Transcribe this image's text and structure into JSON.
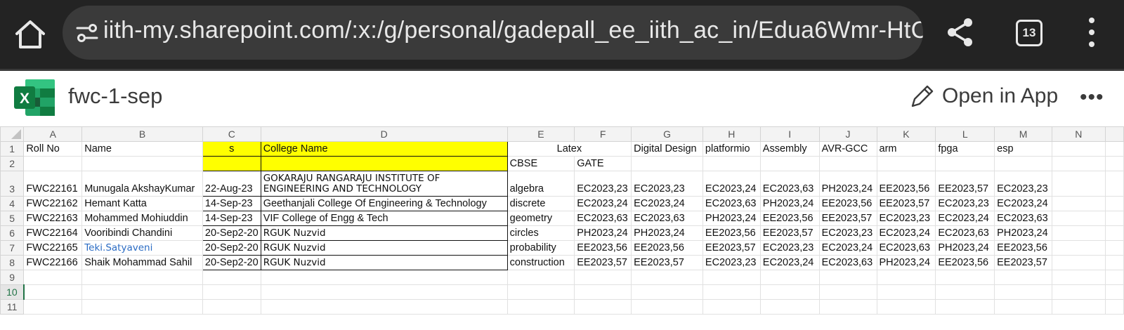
{
  "browser": {
    "url": "iith-my.sharepoint.com/:x:/g/personal/gadepall_ee_iith_ac_in/Edua6Wmr-HtC",
    "tab_count": "13"
  },
  "app": {
    "file_title": "fwc-1-sep",
    "open_in_app_label": "Open in App",
    "more_label": "•••",
    "accent_color": "#217346"
  },
  "grid": {
    "column_headers": [
      "A",
      "B",
      "C",
      "D",
      "E",
      "F",
      "G",
      "H",
      "I",
      "J",
      "K",
      "L",
      "M",
      "N"
    ],
    "row_numbers": [
      "1",
      "2",
      "3",
      "4",
      "5",
      "6",
      "7",
      "8",
      "9",
      "10",
      "11"
    ],
    "header_row": {
      "a": "Roll No",
      "b": "Name",
      "c": "s",
      "d": "College Name",
      "ef": "Latex",
      "g": "Digital Design",
      "h": "platformio",
      "i": "Assembly",
      "j": "AVR-GCC",
      "k": "arm",
      "l": "fpga",
      "m": "esp"
    },
    "row2": {
      "e": "CBSE",
      "f": "GATE"
    },
    "rows": [
      {
        "a": "FWC22161",
        "b": "Munugala AkshayKumar",
        "c": "22-Aug-23",
        "d": "GOKARAJU RANGARAJU INSTITUTE OF ENGINEERING AND TECHNOLOGY",
        "e": "algebra",
        "f": "EC2023,23",
        "g": "EC2023,23",
        "h": "EC2023,24",
        "i": "EC2023,63",
        "j": "PH2023,24",
        "k": "EE2023,56",
        "l": "EE2023,57",
        "m": "EC2023,23"
      },
      {
        "a": "FWC22162",
        "b": "Hemant Katta",
        "c": "14-Sep-23",
        "d": "Geethanjali College Of Engineering & Technology",
        "e": "discrete",
        "f": "EC2023,24",
        "g": "EC2023,24",
        "h": "EC2023,63",
        "i": "PH2023,24",
        "j": "EE2023,56",
        "k": "EE2023,57",
        "l": "EC2023,23",
        "m": "EC2023,24"
      },
      {
        "a": "FWC22163",
        "b": "Mohammed Mohiuddin",
        "c": "14-Sep-23",
        "d": "VIF College of Engg & Tech",
        "e": "geometry",
        "f": "EC2023,63",
        "g": "EC2023,63",
        "h": "PH2023,24",
        "i": "EE2023,56",
        "j": "EE2023,57",
        "k": "EC2023,23",
        "l": "EC2023,24",
        "m": "EC2023,63"
      },
      {
        "a": "FWC22164",
        "b": "Vooribindi Chandini",
        "c": "20-Sep2-20",
        "d": "RGUK Nuzvid",
        "e": "circles",
        "f": "PH2023,24",
        "g": "PH2023,24",
        "h": "EE2023,56",
        "i": "EE2023,57",
        "j": "EC2023,23",
        "k": "EC2023,24",
        "l": "EC2023,63",
        "m": "PH2023,24"
      },
      {
        "a": "FWC22165",
        "b": "Teki.Satyaveni",
        "c": "20-Sep2-20",
        "d": "RGUK Nuzvid",
        "e": "probability",
        "f": "EE2023,56",
        "g": "EE2023,56",
        "h": "EE2023,57",
        "i": "EC2023,23",
        "j": "EC2023,24",
        "k": "EC2023,63",
        "l": "PH2023,24",
        "m": "EE2023,56"
      },
      {
        "a": "FWC22166",
        "b": "Shaik Mohammad Sahil",
        "c": "20-Sep2-20",
        "d": "RGUK Nuzvid",
        "e": "construction",
        "f": "EE2023,57",
        "g": "EE2023,57",
        "h": "EC2023,23",
        "i": "EC2023,24",
        "j": "EC2023,63",
        "k": "PH2023,24",
        "l": "EE2023,56",
        "m": "EE2023,57"
      }
    ],
    "active_row": "10"
  }
}
